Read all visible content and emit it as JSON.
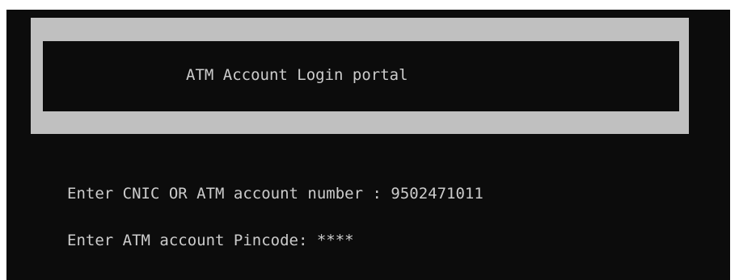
{
  "banner": {
    "title": "ATM Account Login portal"
  },
  "prompts": [
    {
      "label": "Enter CNIC OR ATM account number : ",
      "value": "9502471011"
    },
    {
      "label": "Enter ATM account Pincode: ",
      "value": "****"
    }
  ],
  "colors": {
    "console_background": "#0c0c0c",
    "console_text": "#cccccc",
    "banner_frame": "#c0c0c0"
  }
}
